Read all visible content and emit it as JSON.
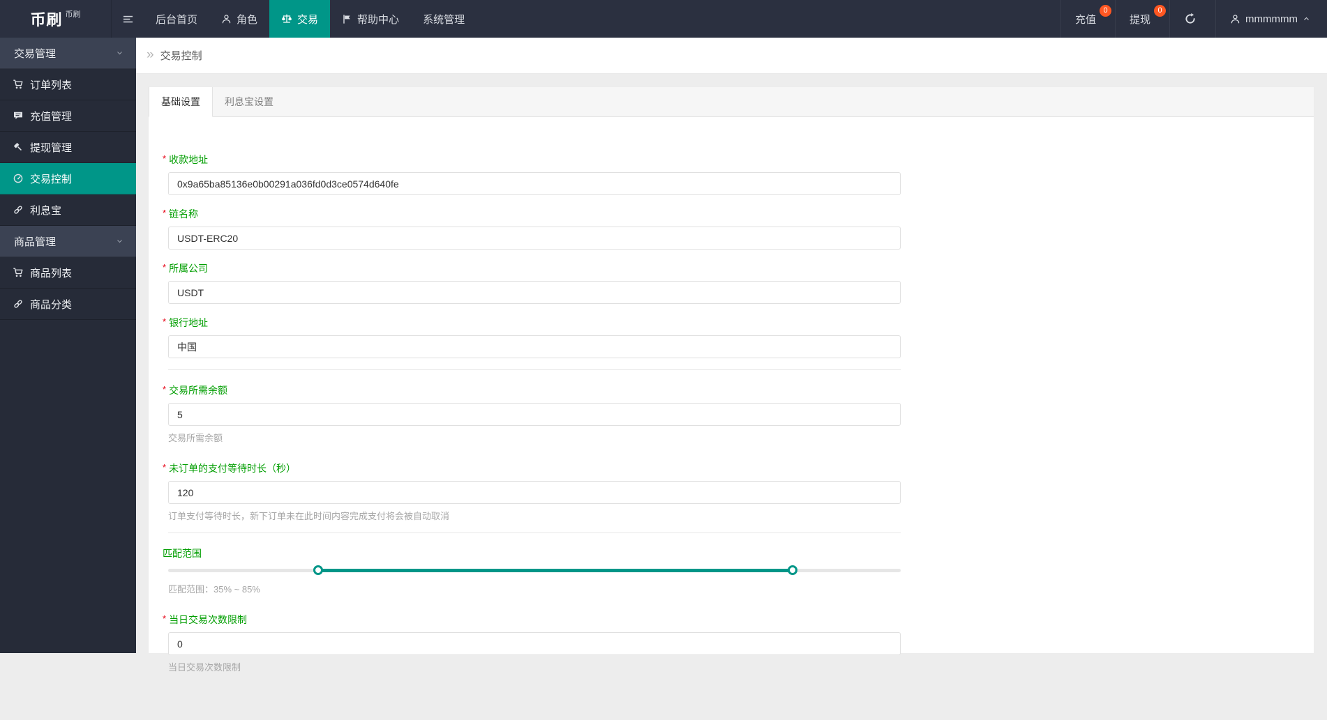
{
  "topbar": {
    "logo": {
      "title": "币刷",
      "subtitle": "币刷"
    },
    "nav": [
      {
        "label": "后台首页",
        "icon": null,
        "active": false
      },
      {
        "label": "角色",
        "icon": "user-icon",
        "active": false
      },
      {
        "label": "交易",
        "icon": "scales-icon",
        "active": true
      },
      {
        "label": "帮助中心",
        "icon": "flag-icon",
        "active": false
      },
      {
        "label": "系统管理",
        "icon": null,
        "active": false
      }
    ],
    "actions": [
      {
        "label": "充值",
        "badge": "0"
      },
      {
        "label": "提现",
        "badge": "0"
      }
    ],
    "user": {
      "name": "mmmmmm"
    }
  },
  "sidebar": {
    "items": [
      {
        "type": "group",
        "label": "交易管理"
      },
      {
        "type": "item",
        "label": "订单列表",
        "icon": "cart-icon",
        "active": false
      },
      {
        "type": "item",
        "label": "充值管理",
        "icon": "chat-icon",
        "active": false
      },
      {
        "type": "item",
        "label": "提现管理",
        "icon": "gavel-icon",
        "active": false
      },
      {
        "type": "item",
        "label": "交易控制",
        "icon": "gauge-icon",
        "active": true
      },
      {
        "type": "item",
        "label": "利息宝",
        "icon": "link-icon",
        "active": false
      },
      {
        "type": "group",
        "label": "商品管理"
      },
      {
        "type": "item",
        "label": "商品列表",
        "icon": "cart-icon",
        "active": false
      },
      {
        "type": "item",
        "label": "商品分类",
        "icon": "link-icon",
        "active": false
      }
    ]
  },
  "breadcrumb": {
    "title": "交易控制"
  },
  "tabs": [
    {
      "label": "基础设置",
      "active": true
    },
    {
      "label": "利息宝设置",
      "active": false
    }
  ],
  "form": {
    "fields": [
      {
        "type": "text",
        "label": "收款地址",
        "required": true,
        "value": "0x9a65ba85136e0b00291a036fd0d3ce0574d640fe",
        "help": null,
        "divider_after": false
      },
      {
        "type": "text",
        "label": "链名称",
        "required": true,
        "value": "USDT-ERC20",
        "help": null,
        "divider_after": false
      },
      {
        "type": "text",
        "label": "所属公司",
        "required": true,
        "value": "USDT",
        "help": null,
        "divider_after": false
      },
      {
        "type": "text",
        "label": "银行地址",
        "required": true,
        "value": "中国",
        "help": null,
        "divider_after": true
      },
      {
        "type": "text",
        "label": "交易所需余额",
        "required": true,
        "value": "5",
        "help": "交易所需余额",
        "divider_after": false
      },
      {
        "type": "text",
        "label": "未订单的支付等待时长（秒）",
        "required": true,
        "value": "120",
        "help": "订单支付等待时长，新下订单未在此时间内容完成支付将会被自动取消",
        "divider_after": true
      },
      {
        "type": "range",
        "label": "匹配范围",
        "required": false,
        "value": null,
        "help": "匹配范围：35% ~ 85%",
        "divider_after": false,
        "range": {
          "from": "35%",
          "to": "85%",
          "handle_positions_percent": [
            20.5,
            85.2
          ]
        }
      },
      {
        "type": "text",
        "label": "当日交易次数限制",
        "required": true,
        "value": "0",
        "help": "当日交易次数限制",
        "divider_after": false
      }
    ]
  },
  "colors": {
    "accent": "#009688",
    "badge": "#ff5722",
    "label_green": "#009e00",
    "topbar_bg": "#2b3040",
    "sidebar_bg": "#262b38"
  }
}
